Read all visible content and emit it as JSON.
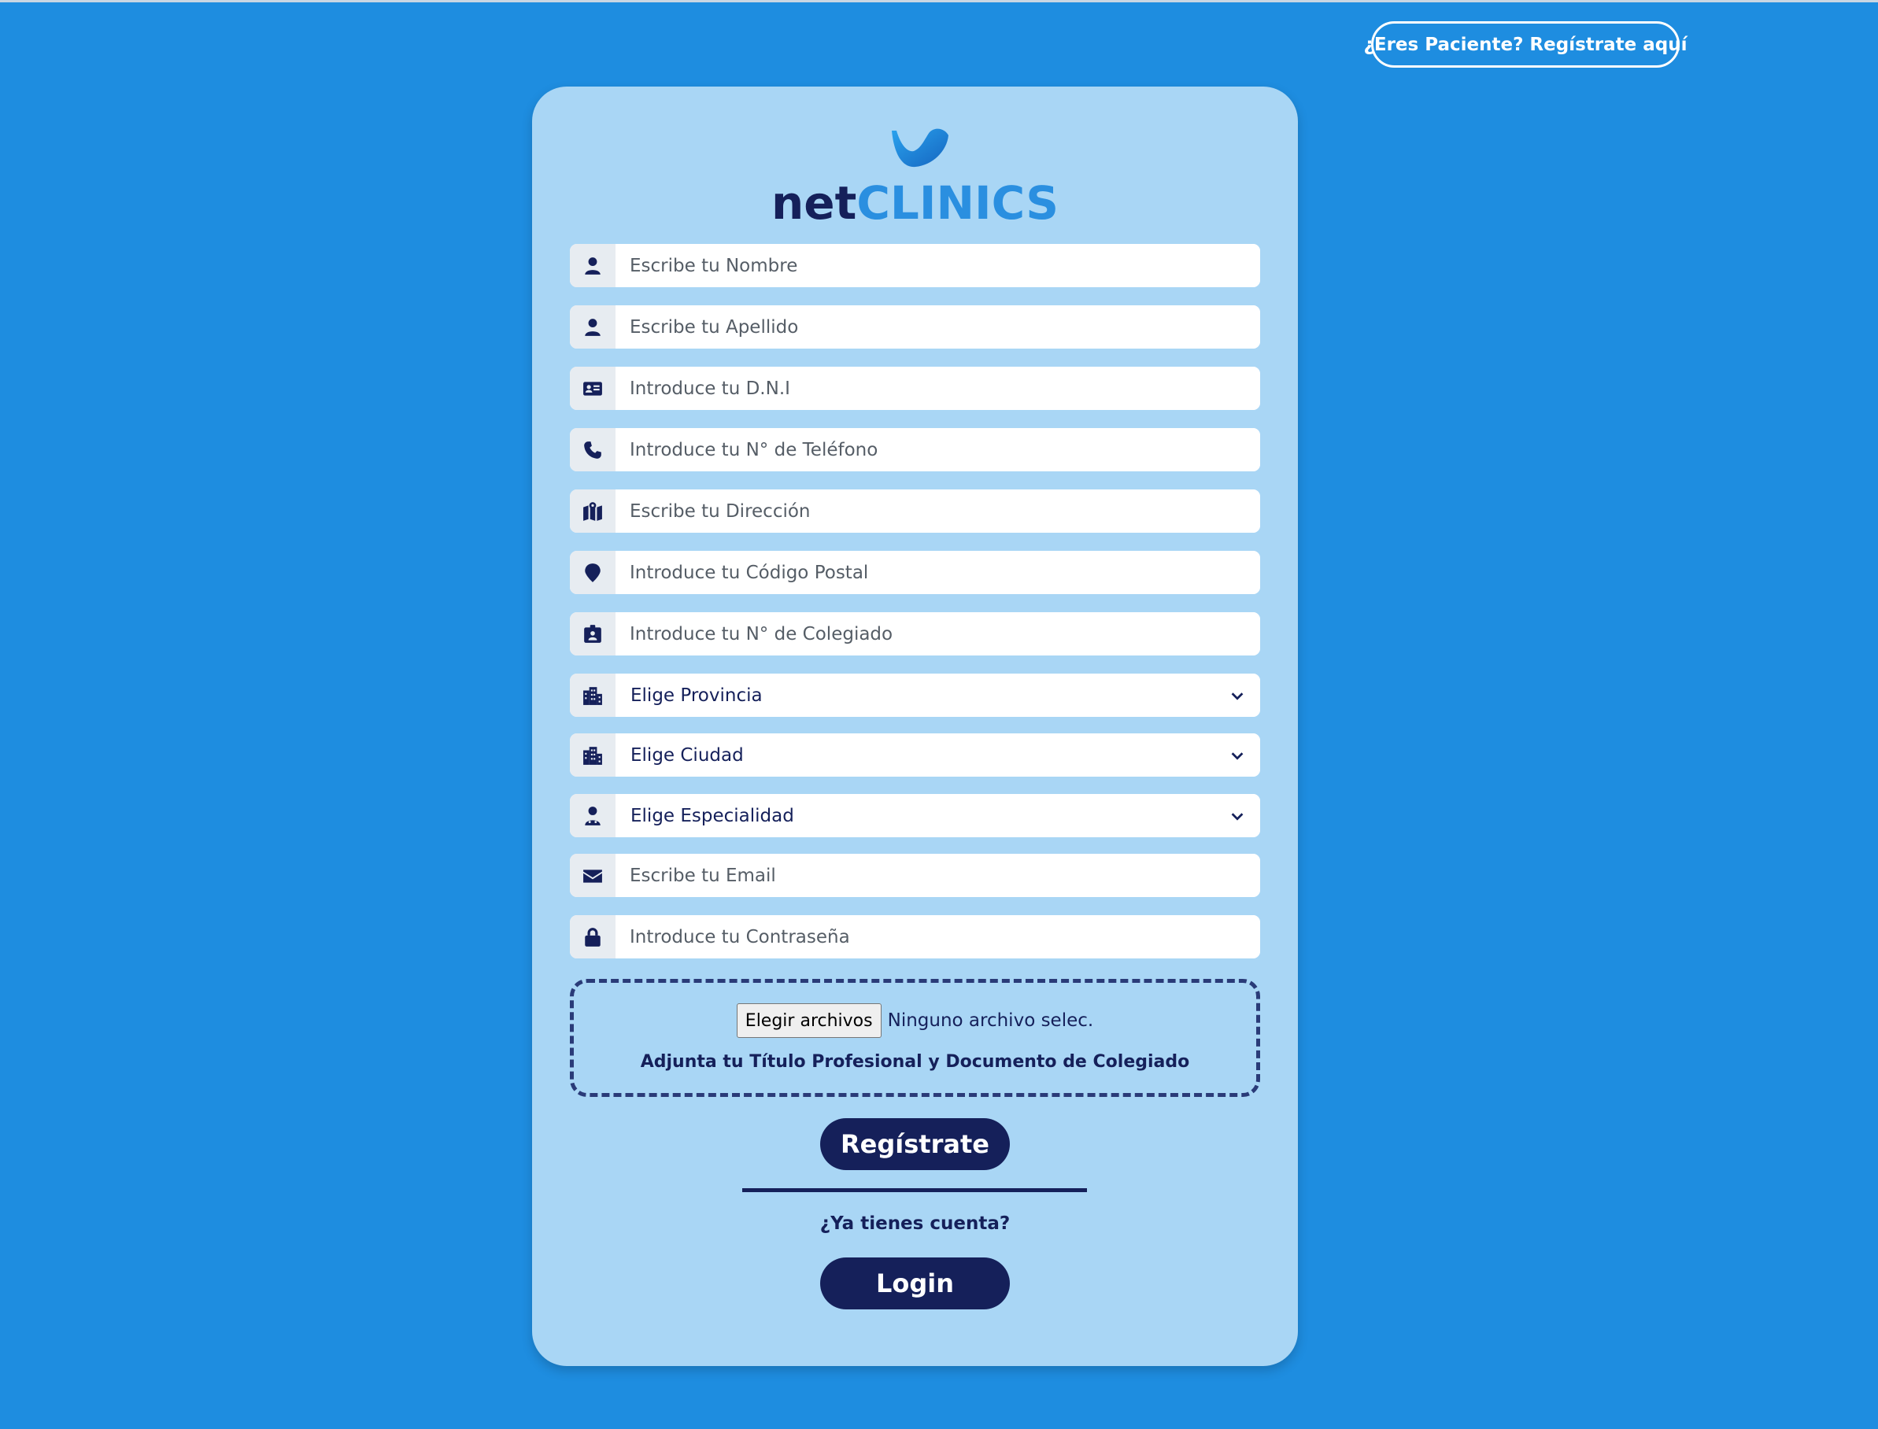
{
  "header": {
    "patient_link": "¿Eres Paciente? Regístrate aquí"
  },
  "brand": {
    "name_part1": "net",
    "name_part2": "CLINICS",
    "colors": {
      "dark": "#15205a",
      "accent": "#2a8fe0",
      "background": "#1e8de0",
      "card": "#a9d6f5"
    }
  },
  "form": {
    "fields": [
      {
        "icon": "user-icon",
        "placeholder": "Escribe tu Nombre"
      },
      {
        "icon": "user-icon",
        "placeholder": "Escribe tu Apellido"
      },
      {
        "icon": "id-card-icon",
        "placeholder": "Introduce tu D.N.I"
      },
      {
        "icon": "phone-icon",
        "placeholder": "Introduce tu N° de Teléfono"
      },
      {
        "icon": "map-icon",
        "placeholder": "Escribe tu Dirección"
      },
      {
        "icon": "map-pin-icon",
        "placeholder": "Introduce tu Código Postal"
      },
      {
        "icon": "id-badge-icon",
        "placeholder": "Introduce tu N° de Colegiado"
      }
    ],
    "selects": [
      {
        "icon": "city-icon",
        "value": "Elige Provincia"
      },
      {
        "icon": "city-icon",
        "value": "Elige Ciudad"
      },
      {
        "icon": "doctor-icon",
        "value": "Elige Especialidad"
      }
    ],
    "email": {
      "icon": "envelope-icon",
      "placeholder": "Escribe tu Email"
    },
    "password": {
      "icon": "lock-icon",
      "placeholder": "Introduce tu Contraseña"
    },
    "upload": {
      "button_label": "Elegir archivos",
      "status": "Ninguno archivo selec.",
      "hint": "Adjunta tu Título Profesional y Documento de Colegiado"
    },
    "register_label": "Regístrate",
    "have_account": "¿Ya tienes cuenta?",
    "login_label": "Login"
  }
}
